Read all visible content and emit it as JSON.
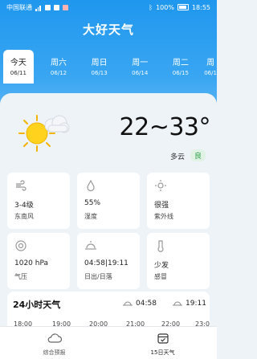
{
  "status_bar": {
    "carrier": "中国联通",
    "battery": "100%",
    "time": "18:55"
  },
  "app": {
    "title": "大好天气"
  },
  "days": [
    {
      "label": "今天",
      "date": "06/11",
      "active": true
    },
    {
      "label": "周六",
      "date": "06/12"
    },
    {
      "label": "周日",
      "date": "06/13"
    },
    {
      "label": "周一",
      "date": "06/14"
    },
    {
      "label": "周二",
      "date": "06/15"
    },
    {
      "label": "周",
      "date": "06/1"
    }
  ],
  "current": {
    "icon": "sun-cloud-icon",
    "temp_range": "22~33°",
    "condition": "多云",
    "aqi": "良"
  },
  "details": [
    {
      "icon": "wind-icon",
      "value": "3-4级",
      "label": "东南风"
    },
    {
      "icon": "drop-icon",
      "value": "55%",
      "label": "湿度"
    },
    {
      "icon": "sun-uv-icon",
      "value": "很强",
      "label": "紫外线"
    },
    {
      "icon": "pressure-icon",
      "value": "1020 hPa",
      "label": "气压"
    },
    {
      "icon": "sunrise-icon",
      "value": "04:58|19:11",
      "label": "日出/日落"
    },
    {
      "icon": "feel-icon",
      "value": "少发",
      "label": "感冒"
    }
  ],
  "hourly": {
    "title": "24小时天气",
    "sunrise": "04:58",
    "sunset": "19:11",
    "hours": [
      "18:00",
      "19:00",
      "20:00",
      "21:00",
      "22:00",
      "23:0"
    ]
  },
  "bottom_nav": [
    {
      "label": "综合预报",
      "icon": "cloud-icon"
    },
    {
      "label": "15日天气",
      "icon": "calendar-icon"
    }
  ],
  "colors": {
    "sky": "#1f97ee",
    "aqi_green": "#2e9d4a"
  }
}
